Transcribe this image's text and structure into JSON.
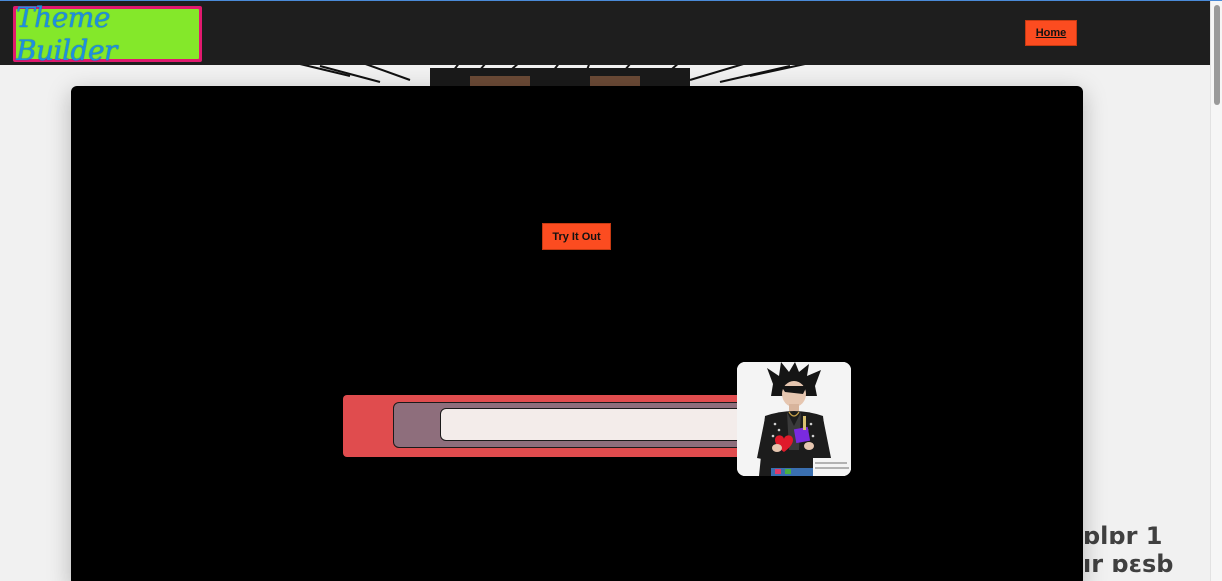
{
  "header": {
    "logo_text": "Theme Builder",
    "nav": {
      "home_label": "Home"
    }
  },
  "main": {
    "try_button_label": "Try It Out",
    "input": {
      "value": "",
      "placeholder": ""
    }
  },
  "colors": {
    "accent": "#fc4c20",
    "header_bg": "#1e1e1e",
    "logo_border": "#e0196e",
    "logo_bg": "#84e82a",
    "logo_text": "#1e8fe0",
    "panel_bg": "#000000",
    "widget_outer": "#e04c4e",
    "widget_mid": "#8e6e7c",
    "widget_input": "#f3ecea"
  },
  "icons": [
    "avatar-character-image",
    "heart-shape",
    "hair-background-image"
  ]
}
